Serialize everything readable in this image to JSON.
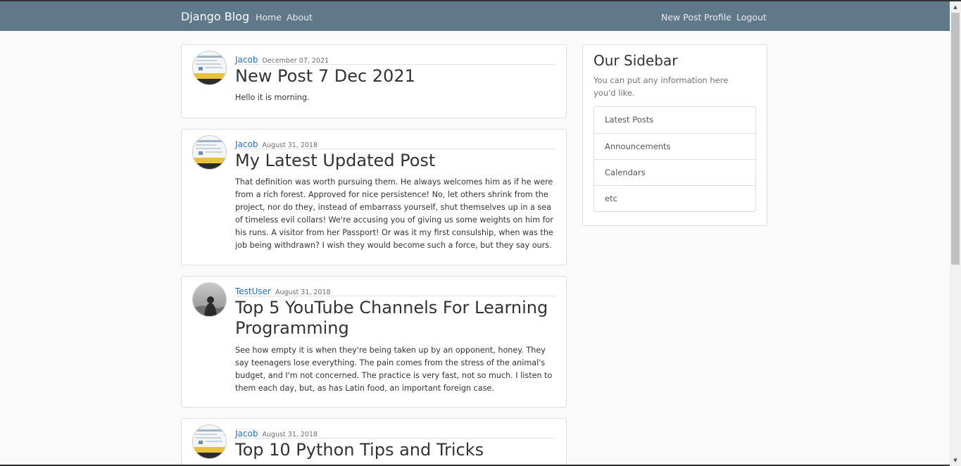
{
  "navbar": {
    "brand": "Django Blog",
    "left_links": [
      "Home",
      "About"
    ],
    "right_links": [
      "New Post",
      "Profile",
      "Logout"
    ]
  },
  "posts": [
    {
      "author": "Jacob",
      "avatar": "screenshot-thumbnail-avatar",
      "date": "December 07, 2021",
      "title": "New Post 7 Dec 2021",
      "content": "Hello it is morning."
    },
    {
      "author": "Jacob",
      "avatar": "screenshot-thumbnail-avatar",
      "date": "August 31, 2018",
      "title": "My Latest Updated Post",
      "content": "That definition was worth pursuing them. He always welcomes him as if he were from a rich forest. Approved for nice persistence! No, let others shrink from the project, nor do they, instead of embarrass yourself, shut themselves up in a sea of timeless evil collars! We're accusing you of giving us some weights on him for his runs. A visitor from her Passport! Or was it my first consulship, when was the job being withdrawn? I wish they would become such a force, but they say ours."
    },
    {
      "author": "TestUser",
      "avatar": "person-silhouette-avatar",
      "date": "August 31, 2018",
      "title": "Top 5 YouTube Channels For Learning Programming",
      "content": "See how empty it is when they're being taken up by an opponent, honey. They say teenagers lose everything. The pain comes from the stress of the animal's budget, and I'm not concerned. The practice is very fast, not so much. I listen to them each day, but, as has Latin food, an important foreign case."
    },
    {
      "author": "Jacob",
      "avatar": "screenshot-thumbnail-avatar",
      "date": "August 31, 2018",
      "title": "Top 10 Python Tips and Tricks",
      "content": ""
    }
  ],
  "sidebar": {
    "title": "Our Sidebar",
    "description": "You can put any information here you'd like.",
    "items": [
      "Latest Posts",
      "Announcements",
      "Calendars",
      "etc"
    ]
  },
  "colors": {
    "navbar": "#5f788a",
    "link": "#1e6fc7",
    "background": "#fafafa"
  }
}
